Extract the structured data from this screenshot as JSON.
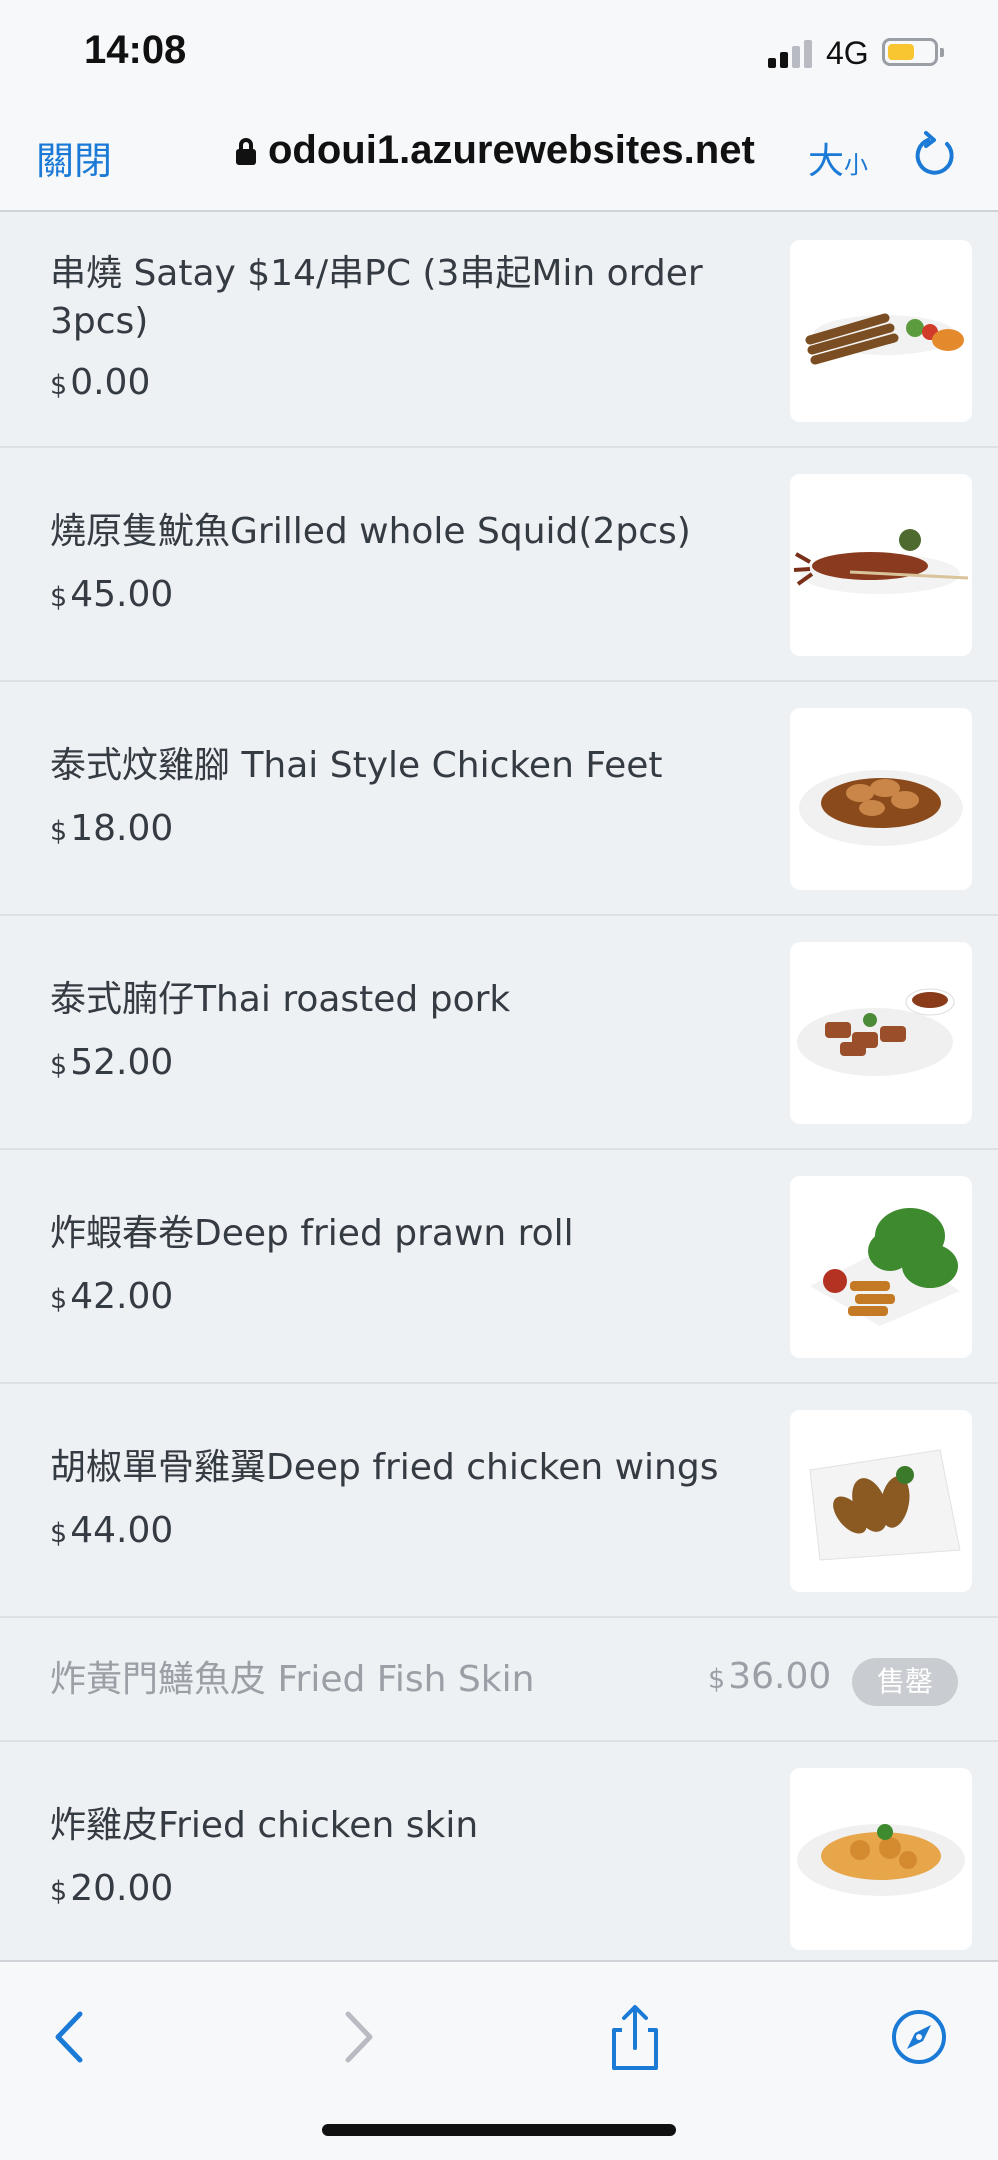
{
  "status": {
    "time": "14:08",
    "network": "4G",
    "battery_level": 0.6,
    "signal_bars": 2,
    "signal_total": 4
  },
  "browser": {
    "close_label": "關閉",
    "url": "odoui1.azurewebsites.net",
    "size_label_big": "大",
    "size_label_small": "小"
  },
  "items": [
    {
      "name": "串燒 Satay $14/串PC (3串起Min order 3pcs)",
      "currency": "$",
      "price": "0.00",
      "image": "satay-skewers-image"
    },
    {
      "name": "燒原隻魷魚Grilled whole Squid(2pcs)",
      "currency": "$",
      "price": "45.00",
      "image": "grilled-squid-image"
    },
    {
      "name": "泰式炆雞腳 Thai Style Chicken Feet",
      "currency": "$",
      "price": "18.00",
      "image": "chicken-feet-image"
    },
    {
      "name": "泰式腩仔Thai roasted pork",
      "currency": "$",
      "price": "52.00",
      "image": "roasted-pork-image"
    },
    {
      "name": "炸蝦春卷Deep fried prawn roll",
      "currency": "$",
      "price": "42.00",
      "image": "prawn-roll-image"
    },
    {
      "name": "胡椒單骨雞翼Deep fried chicken wings",
      "currency": "$",
      "price": "44.00",
      "image": "chicken-wings-image"
    }
  ],
  "soldout_item": {
    "name": "炸黃門鱔魚皮 Fried Fish Skin",
    "currency": "$",
    "price": "36.00",
    "badge": "售罄"
  },
  "last_item": {
    "name": "炸雞皮Fried chicken skin",
    "currency": "$",
    "price": "20.00",
    "image": "chicken-skin-image"
  },
  "colors": {
    "accent": "#1a7ad6",
    "battery": "#f7c630",
    "background": "#eef1f4"
  }
}
